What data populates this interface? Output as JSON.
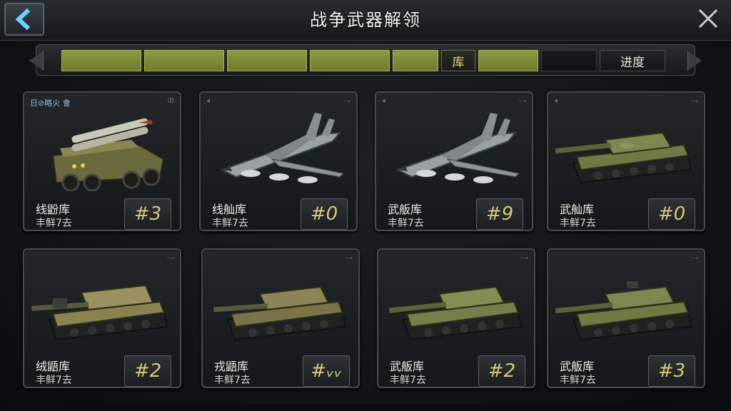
{
  "header": {
    "title": "战争武器解领"
  },
  "tabs": {
    "active_label": "库",
    "progress_label": "进度"
  },
  "cards": [
    {
      "tag": "日⊘略火 會",
      "name": "线鼢库",
      "sub": "丰鲜7去",
      "count": "#3",
      "vehicle": "missile-truck"
    },
    {
      "tag": "",
      "name": "线舢库",
      "sub": "丰鲜7去",
      "count": "#0",
      "vehicle": "fighter-jet"
    },
    {
      "tag": "",
      "name": "武舨库",
      "sub": "丰鲜7去",
      "count": "#9",
      "vehicle": "fighter-jet"
    },
    {
      "tag": "",
      "name": "武舢库",
      "sub": "丰鲜7去",
      "count": "#0",
      "vehicle": "tank"
    },
    {
      "tag": "",
      "name": "绒鼯库",
      "sub": "丰鲜7去",
      "count": "#2",
      "vehicle": "tank"
    },
    {
      "tag": "",
      "name": "戎鼯库",
      "sub": "丰鲜7去",
      "count": "#ᵥᵥ",
      "vehicle": "tank"
    },
    {
      "tag": "",
      "name": "武舨库",
      "sub": "丰鲜7去",
      "count": "#2",
      "vehicle": "tank"
    },
    {
      "tag": "",
      "name": "武舨库",
      "sub": "丰鲜7去",
      "count": "#3",
      "vehicle": "tank"
    }
  ],
  "colors": {
    "accent_green": "#8e9a43",
    "count_gold": "#d9c67a",
    "back_arrow": "#6fd0ff"
  },
  "icons": {
    "back": "chevron-left-icon",
    "close": "close-icon"
  }
}
